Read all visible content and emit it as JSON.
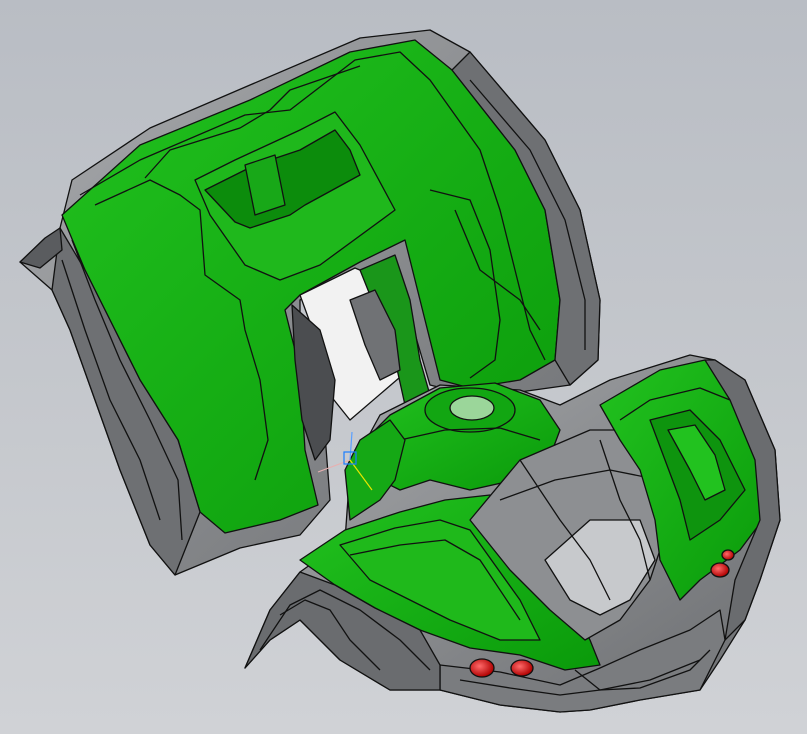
{
  "viewport": {
    "background_top": "#b9bdc4",
    "background_bottom": "#d0d2d6"
  },
  "model": {
    "parts": [
      "rear-fender-body",
      "front-fender-body"
    ],
    "colors": {
      "green_face": "#0fa00f",
      "green_light": "#2fc52a",
      "green_dark": "#067806",
      "gray_face": "#8c8e91",
      "gray_light": "#b8babd",
      "gray_dark": "#55575a",
      "edge": "#111111",
      "light_red": "#e01818"
    },
    "icons": [
      "axis-triad-icon"
    ]
  }
}
